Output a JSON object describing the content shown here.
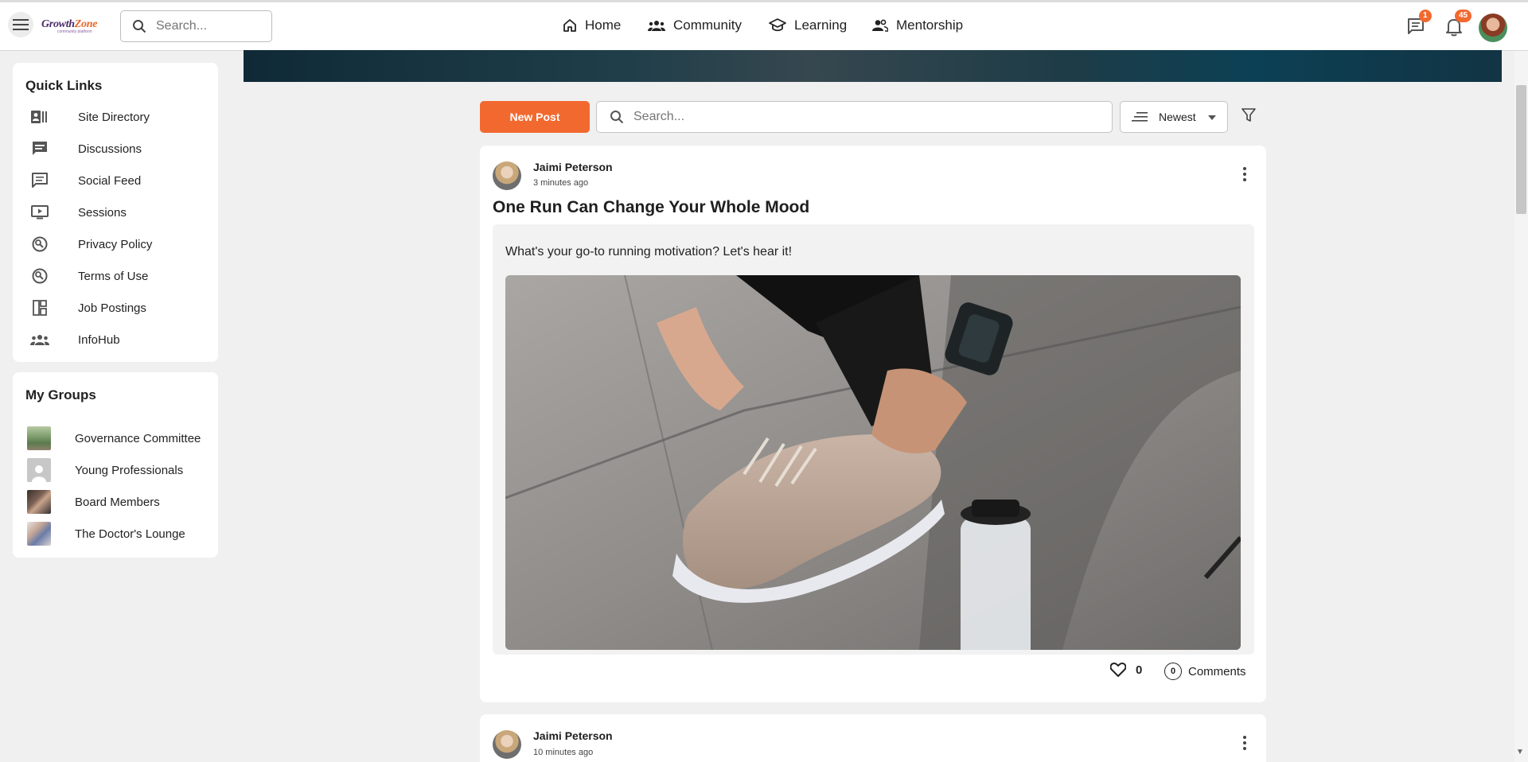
{
  "header": {
    "logo_text_main": "Growth",
    "logo_text_accent": "Zone",
    "logo_tagline": "community platform",
    "search_placeholder": "Search...",
    "nav": [
      {
        "label": "Home"
      },
      {
        "label": "Community"
      },
      {
        "label": "Learning"
      },
      {
        "label": "Mentorship"
      }
    ],
    "messages_badge": "1",
    "notifications_badge": "45"
  },
  "quick_links": {
    "title": "Quick Links",
    "items": [
      {
        "label": "Site Directory",
        "icon": "directory-icon"
      },
      {
        "label": "Discussions",
        "icon": "discussion-icon"
      },
      {
        "label": "Social Feed",
        "icon": "feed-icon"
      },
      {
        "label": "Sessions",
        "icon": "video-icon"
      },
      {
        "label": "Privacy Policy",
        "icon": "policy-icon"
      },
      {
        "label": "Terms of Use",
        "icon": "policy-icon"
      },
      {
        "label": "Job Postings",
        "icon": "dashboard-icon"
      },
      {
        "label": "InfoHub",
        "icon": "group-icon"
      }
    ]
  },
  "my_groups": {
    "title": "My Groups",
    "items": [
      {
        "label": "Governance Committee"
      },
      {
        "label": "Young Professionals"
      },
      {
        "label": "Board Members"
      },
      {
        "label": "The Doctor's Lounge"
      }
    ]
  },
  "feed": {
    "new_post_label": "New Post",
    "search_placeholder": "Search...",
    "sort_value": "Newest"
  },
  "posts": [
    {
      "author": "Jaimi Peterson",
      "time": "3 minutes ago",
      "title": "One Run Can Change Your Whole Mood",
      "body": "What's your go-to running motivation? Let's hear it!",
      "likes": "0",
      "comments_count": "0",
      "comments_label": "Comments"
    },
    {
      "author": "Jaimi Peterson",
      "time": "10 minutes ago"
    }
  ],
  "colors": {
    "accent": "#f26930",
    "brand_purple": "#4b2c6b"
  }
}
